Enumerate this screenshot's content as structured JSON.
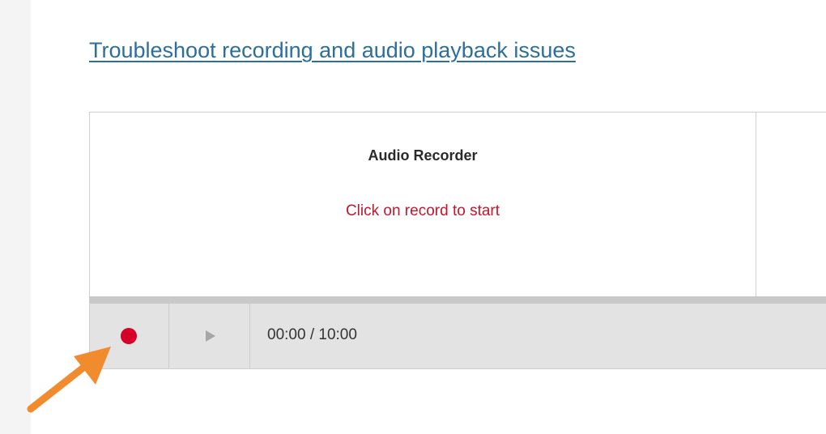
{
  "help": {
    "link_text": "Troubleshoot recording and audio playback issues"
  },
  "recorder": {
    "title": "Audio Recorder",
    "status": "Click on record to start",
    "controls": {
      "record_icon": "record-dot-icon",
      "play_icon": "play-icon",
      "time": "00:00 / 10:00"
    }
  },
  "annotation": {
    "arrow_icon": "arrow-pointer-icon",
    "arrow_color": "#f08c2e"
  },
  "colors": {
    "link": "#2c6f9c",
    "status": "#c0172c",
    "record": "#d6002a"
  }
}
